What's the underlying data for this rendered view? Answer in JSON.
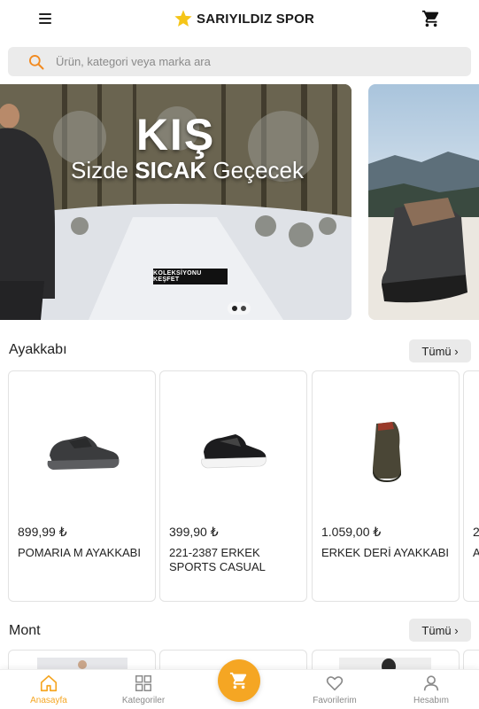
{
  "header": {
    "brand_name": "SARIYILDIZ SPOR",
    "brand_color": "#f5c518",
    "menu_icon": "hamburger-menu-icon",
    "cart_icon": "shopping-cart-icon"
  },
  "search": {
    "placeholder": "Ürün, kategori veya marka ara",
    "value": "",
    "icon": "search-icon",
    "icon_color": "#f28a1f"
  },
  "banner": {
    "title": "KIŞ",
    "subtitle_prefix": "Sizde ",
    "subtitle_bold": "SICAK",
    "subtitle_suffix": " Geçecek",
    "cta_label": "KOLEKSİYONU KEŞFET",
    "slide_count": 2,
    "active_slide": 1
  },
  "sections": [
    {
      "title": "Ayakkabı",
      "all_label": "Tümü ›",
      "products": [
        {
          "price": "899,99 ₺",
          "name": "POMARIA M AYAKKABI"
        },
        {
          "price": "399,90 ₺",
          "name": "221-2387 ERKEK SPORTS CASUAL"
        },
        {
          "price": "1.059,00 ₺",
          "name": "ERKEK DERİ AYAKKABI"
        },
        {
          "price": "2",
          "name": "A"
        }
      ]
    },
    {
      "title": "Mont",
      "all_label": "Tümü ›"
    }
  ],
  "bottom_nav": {
    "accent_color": "#f5a623",
    "items": [
      {
        "label": "Anasayfa",
        "icon": "home-icon",
        "active": true
      },
      {
        "label": "Kategoriler",
        "icon": "grid-icon",
        "active": false
      },
      {
        "label": "",
        "icon": "cart-fab-icon",
        "active": false
      },
      {
        "label": "Favorilerim",
        "icon": "heart-icon",
        "active": false
      },
      {
        "label": "Hesabım",
        "icon": "user-icon",
        "active": false
      }
    ]
  }
}
